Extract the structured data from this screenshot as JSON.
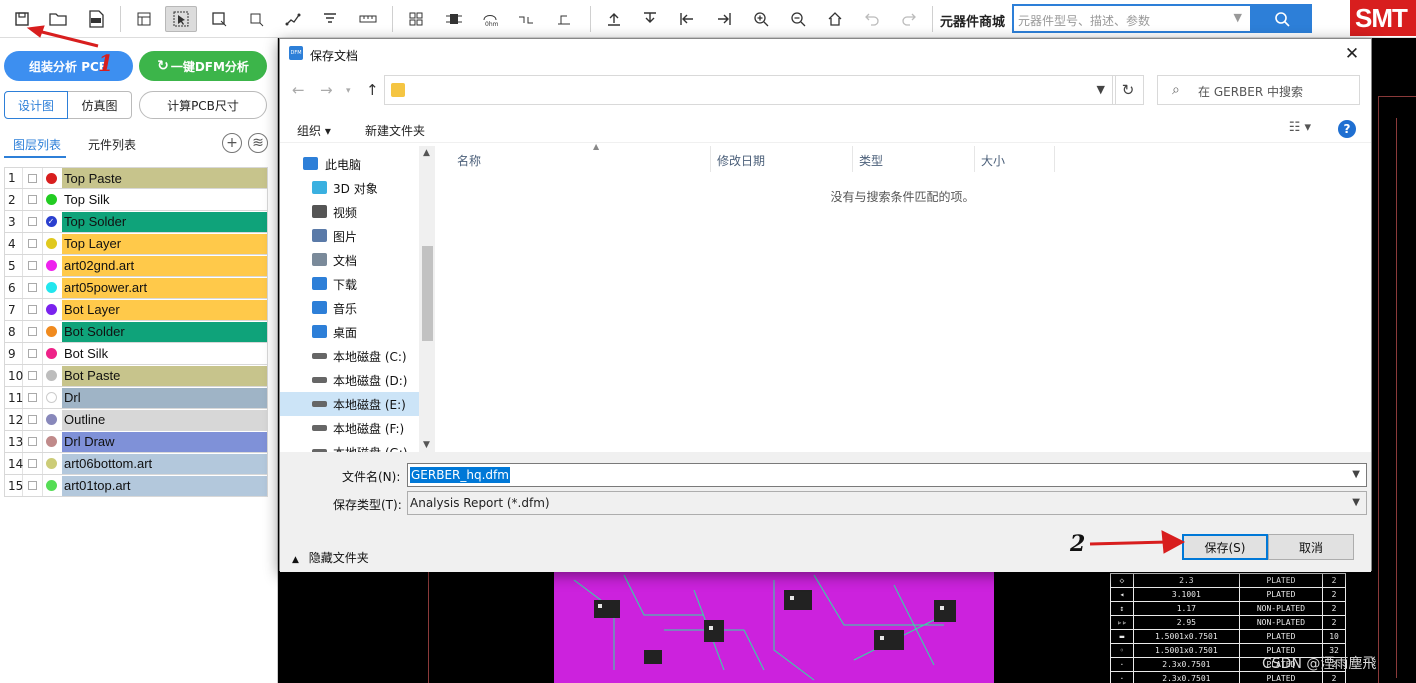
{
  "toolbar": {
    "mall_label": "元器件商城",
    "mall_search_placeholder": "元器件型号、描述、参数",
    "logo_text": "SMT"
  },
  "left_panel": {
    "btn_assembly": "组装分析 PCB",
    "btn_dfm": "一键DFM分析",
    "seg_design": "设计图",
    "seg_sim": "仿真图",
    "btn_calc_size": "计算PCB尺寸",
    "tab_layers": "图层列表",
    "tab_parts": "元件列表",
    "layers": [
      {
        "num": "1",
        "name": "Top Paste",
        "dot": "#d81e1e",
        "bg": "#c7c48c"
      },
      {
        "num": "2",
        "name": "Top Silk",
        "dot": "#22cc22",
        "bg": "#ffffff"
      },
      {
        "num": "3",
        "name": "Top Solder",
        "dot": "#2a3fcf",
        "bg": "#0fa37a",
        "checked": true
      },
      {
        "num": "4",
        "name": "Top Layer",
        "dot": "#e0c91e",
        "bg": "#ffc94a"
      },
      {
        "num": "5",
        "name": "art02gnd.art",
        "dot": "#ee22ee",
        "bg": "#ffc94a"
      },
      {
        "num": "6",
        "name": "art05power.art",
        "dot": "#22e6ee",
        "bg": "#ffc94a"
      },
      {
        "num": "7",
        "name": "Bot Layer",
        "dot": "#7a22ee",
        "bg": "#ffc94a"
      },
      {
        "num": "8",
        "name": "Bot Solder",
        "dot": "#f08a1e",
        "bg": "#0fa37a"
      },
      {
        "num": "9",
        "name": "Bot Silk",
        "dot": "#ee2288",
        "bg": "#ffffff"
      },
      {
        "num": "10",
        "name": "Bot Paste",
        "dot": "#bdbdbd",
        "bg": "#c7c48c"
      },
      {
        "num": "11",
        "name": "Drl",
        "dot": "#ffffff",
        "bg": "#9fb4c6"
      },
      {
        "num": "12",
        "name": "Outline",
        "dot": "#8888bb",
        "bg": "#d7d7d7"
      },
      {
        "num": "13",
        "name": "Drl Draw",
        "dot": "#c08a8a",
        "bg": "#7f91d8"
      },
      {
        "num": "14",
        "name": "art06bottom.art",
        "dot": "#cccc77",
        "bg": "#b3c8dc"
      },
      {
        "num": "15",
        "name": "art01top.art",
        "dot": "#55dd55",
        "bg": "#b3c8dc"
      }
    ]
  },
  "dialog": {
    "title": "保存文档",
    "app_icon_text": "DFM",
    "search_placeholder": "在 GERBER 中搜索",
    "organize": "组织 ▾",
    "new_folder": "新建文件夹",
    "nav_items": [
      {
        "label": "此电脑",
        "icon": "pc-icon"
      },
      {
        "label": "3D 对象",
        "icon": "cube-icon"
      },
      {
        "label": "视频",
        "icon": "video-icon"
      },
      {
        "label": "图片",
        "icon": "picture-icon"
      },
      {
        "label": "文档",
        "icon": "document-icon"
      },
      {
        "label": "下载",
        "icon": "download-icon"
      },
      {
        "label": "音乐",
        "icon": "music-icon"
      },
      {
        "label": "桌面",
        "icon": "desktop-icon"
      },
      {
        "label": "本地磁盘 (C:)",
        "icon": "drive-icon"
      },
      {
        "label": "本地磁盘 (D:)",
        "icon": "drive-icon"
      },
      {
        "label": "本地磁盘 (E:)",
        "icon": "drive-icon",
        "selected": true
      },
      {
        "label": "本地磁盘 (F:)",
        "icon": "drive-icon"
      },
      {
        "label": "本地磁盘 (G:)",
        "icon": "drive-icon"
      }
    ],
    "columns": [
      "名称",
      "修改日期",
      "类型",
      "大小"
    ],
    "empty_message": "没有与搜索条件匹配的项。",
    "filename_label": "文件名(N):",
    "filename_value": "GERBER_hq.dfm",
    "filetype_label": "保存类型(T):",
    "filetype_value": "Analysis Report (*.dfm)",
    "hide_folders": "隐藏文件夹",
    "save_button": "保存(S)",
    "cancel_button": "取消"
  },
  "canvas": {
    "drill_table": [
      [
        "◇",
        "2.3",
        "PLATED",
        "2"
      ],
      [
        "◂",
        "3.1001",
        "PLATED",
        "2"
      ],
      [
        "↕",
        "1.17",
        "NON-PLATED",
        "2"
      ],
      [
        "▹▹",
        "2.95",
        "NON-PLATED",
        "2"
      ],
      [
        "▬",
        "1.5001x0.7501",
        "PLATED",
        "10"
      ],
      [
        "◦",
        "1.5001x0.7501",
        "PLATED",
        "32"
      ],
      [
        "·",
        "2.3x0.7501",
        "PLATED",
        "2"
      ],
      [
        "·",
        "2.3x0.7501",
        "PLATED",
        "2"
      ]
    ],
    "watermark": "CSDN @湮雨塵飛"
  },
  "annotations": {
    "step1": "1",
    "step2": "2"
  }
}
